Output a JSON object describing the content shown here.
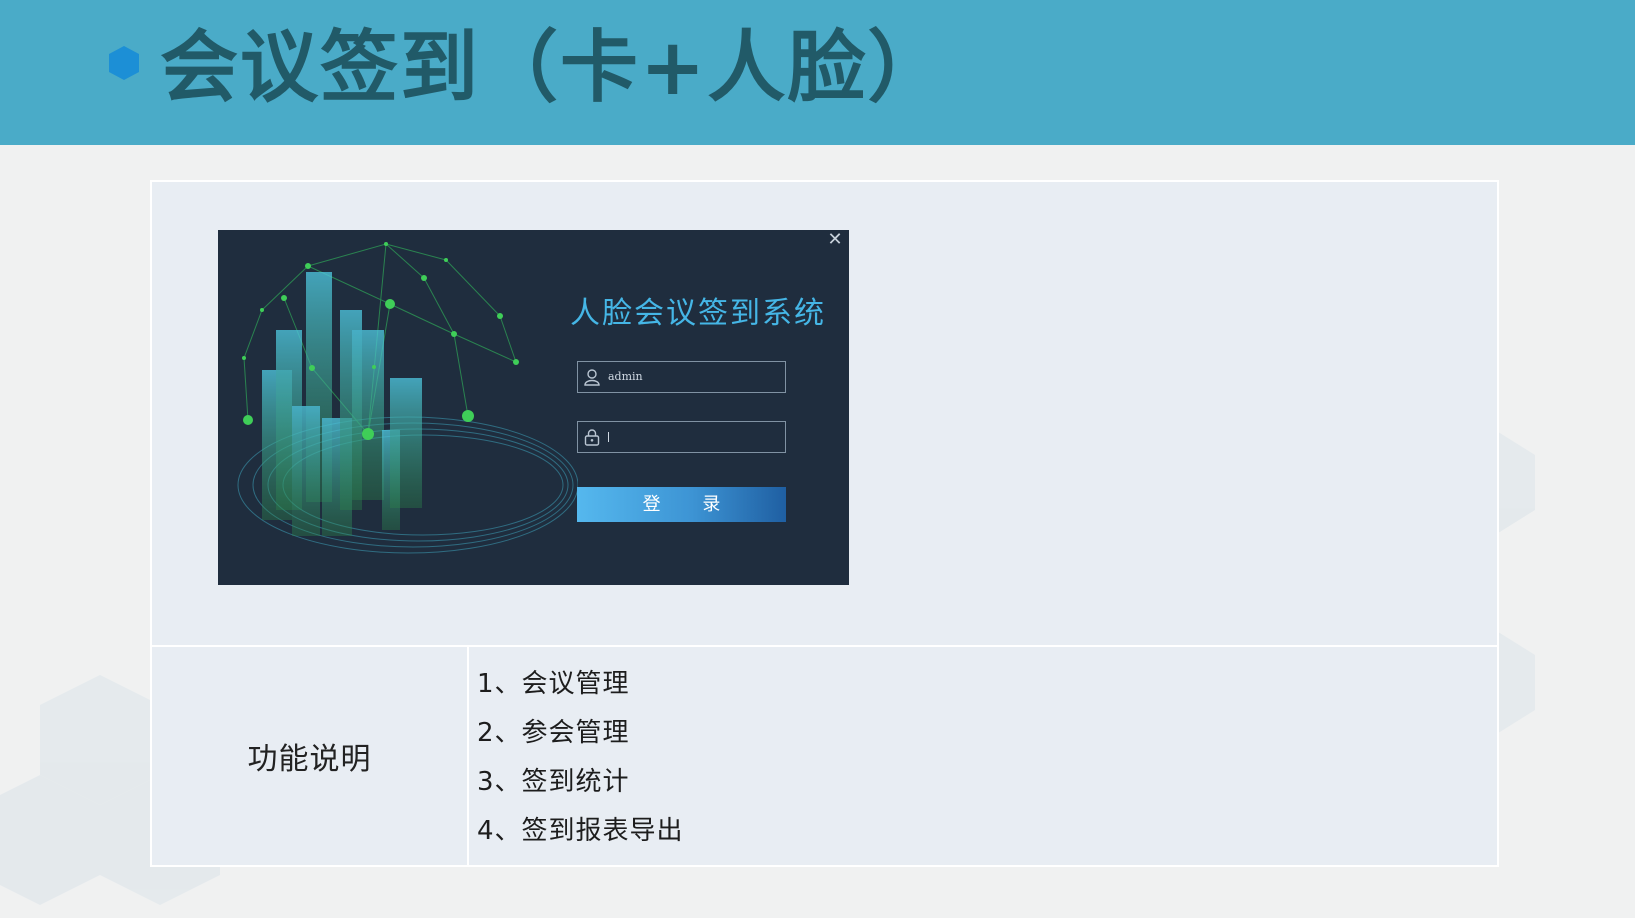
{
  "slide": {
    "title": "会议签到（卡+人脸）"
  },
  "login": {
    "title": "人脸会议签到系统",
    "username_value": "admin",
    "password_value": "",
    "login_label": "登 录",
    "close_glyph": "✕"
  },
  "features": {
    "label": "功能说明",
    "items": [
      "1、会议管理",
      "2、参会管理",
      "3、签到统计",
      "4、签到报表导出"
    ]
  },
  "colors": {
    "title_bar": "#4aabc8",
    "title_text": "#215a68",
    "bullet": "#1c8fd6",
    "login_bg": "#1f2d3e",
    "login_title": "#45b6e6",
    "login_button": "#3d94d4"
  },
  "icons": {
    "title_bullet": "hexagon-icon",
    "username_field": "user-icon",
    "password_field": "lock-icon",
    "close": "close-icon"
  }
}
